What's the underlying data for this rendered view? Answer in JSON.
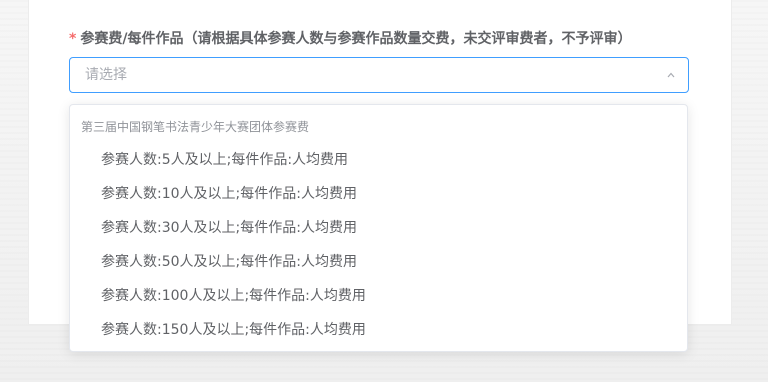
{
  "form": {
    "required_mark": "*",
    "field_label": "参赛费/每件作品（请根据具体参赛人数与参赛作品数量交费，未交评审费者，不予评审）",
    "select_placeholder": "请选择"
  },
  "dropdown": {
    "group_title": "第三届中国钢笔书法青少年大赛团体参赛费",
    "options": [
      "参赛人数:5人及以上;每件作品:人均费用",
      "参赛人数:10人及以上;每件作品:人均费用",
      "参赛人数:30人及以上;每件作品:人均费用",
      "参赛人数:50人及以上;每件作品:人均费用",
      "参赛人数:100人及以上;每件作品:人均费用",
      "参赛人数:150人及以上;每件作品:人均费用"
    ]
  },
  "colors": {
    "accent": "#409eff",
    "required": "#f56c6c",
    "label_text": "#606266",
    "placeholder": "#a8abb2",
    "group_text": "#909399"
  },
  "icons": {
    "select_arrow": "chevron-up-icon"
  }
}
